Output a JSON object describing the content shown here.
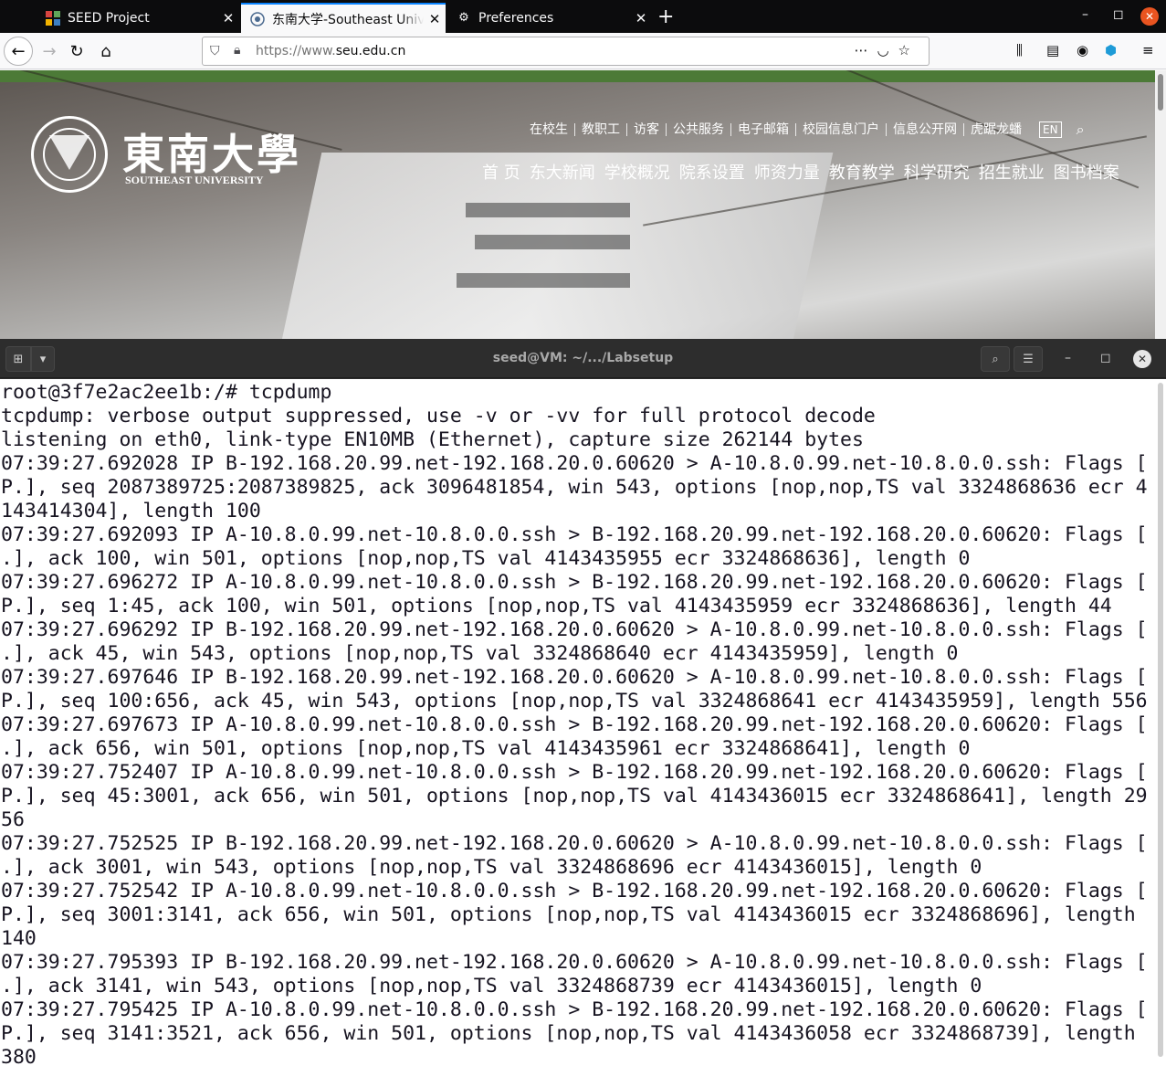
{
  "browser": {
    "tabs": [
      {
        "title": "SEED Project",
        "icon": "seed-grid-icon"
      },
      {
        "title": "东南大学-Southeast University",
        "icon": "seu-seal-icon"
      },
      {
        "title": "Preferences",
        "icon": "gear-icon"
      }
    ],
    "url_prefix": "https://www.",
    "url_domain": "seu.edu.cn",
    "toolbar_icons": [
      "library-icon",
      "reader-view-icon",
      "account-icon",
      "extension-icon",
      "menu-icon"
    ]
  },
  "site": {
    "logo_cn": "東南大學",
    "logo_en": "SOUTHEAST UNIVERSITY",
    "top_nav": [
      "在校生",
      "教职工",
      "访客",
      "公共服务",
      "电子邮箱",
      "校园信息门户",
      "信息公开网",
      "虎踞龙蟠"
    ],
    "lang": "EN",
    "main_nav": [
      "首 页",
      "东大新闻",
      "学校概况",
      "院系设置",
      "师资力量",
      "教育教学",
      "科学研究",
      "招生就业",
      "图书档案"
    ]
  },
  "terminal": {
    "title": "seed@VM: ~/.../Labsetup",
    "lines": [
      "root@3f7e2ac2ee1b:/# tcpdump",
      "tcpdump: verbose output suppressed, use -v or -vv for full protocol decode",
      "listening on eth0, link-type EN10MB (Ethernet), capture size 262144 bytes",
      "07:39:27.692028 IP B-192.168.20.99.net-192.168.20.0.60620 > A-10.8.0.99.net-10.8.0.0.ssh: Flags [",
      "P.], seq 2087389725:2087389825, ack 3096481854, win 543, options [nop,nop,TS val 3324868636 ecr 4",
      "143414304], length 100",
      "07:39:27.692093 IP A-10.8.0.99.net-10.8.0.0.ssh > B-192.168.20.99.net-192.168.20.0.60620: Flags [",
      ".], ack 100, win 501, options [nop,nop,TS val 4143435955 ecr 3324868636], length 0",
      "07:39:27.696272 IP A-10.8.0.99.net-10.8.0.0.ssh > B-192.168.20.99.net-192.168.20.0.60620: Flags [",
      "P.], seq 1:45, ack 100, win 501, options [nop,nop,TS val 4143435959 ecr 3324868636], length 44",
      "07:39:27.696292 IP B-192.168.20.99.net-192.168.20.0.60620 > A-10.8.0.99.net-10.8.0.0.ssh: Flags [",
      ".], ack 45, win 543, options [nop,nop,TS val 3324868640 ecr 4143435959], length 0",
      "07:39:27.697646 IP B-192.168.20.99.net-192.168.20.0.60620 > A-10.8.0.99.net-10.8.0.0.ssh: Flags [",
      "P.], seq 100:656, ack 45, win 543, options [nop,nop,TS val 3324868641 ecr 4143435959], length 556",
      "07:39:27.697673 IP A-10.8.0.99.net-10.8.0.0.ssh > B-192.168.20.99.net-192.168.20.0.60620: Flags [",
      ".], ack 656, win 501, options [nop,nop,TS val 4143435961 ecr 3324868641], length 0",
      "07:39:27.752407 IP A-10.8.0.99.net-10.8.0.0.ssh > B-192.168.20.99.net-192.168.20.0.60620: Flags [",
      "P.], seq 45:3001, ack 656, win 501, options [nop,nop,TS val 4143436015 ecr 3324868641], length 29",
      "56",
      "07:39:27.752525 IP B-192.168.20.99.net-192.168.20.0.60620 > A-10.8.0.99.net-10.8.0.0.ssh: Flags [",
      ".], ack 3001, win 543, options [nop,nop,TS val 3324868696 ecr 4143436015], length 0",
      "07:39:27.752542 IP A-10.8.0.99.net-10.8.0.0.ssh > B-192.168.20.99.net-192.168.20.0.60620: Flags [",
      "P.], seq 3001:3141, ack 656, win 501, options [nop,nop,TS val 4143436015 ecr 3324868696], length",
      "140",
      "07:39:27.795393 IP B-192.168.20.99.net-192.168.20.0.60620 > A-10.8.0.99.net-10.8.0.0.ssh: Flags [",
      ".], ack 3141, win 543, options [nop,nop,TS val 3324868739 ecr 4143436015], length 0",
      "07:39:27.795425 IP A-10.8.0.99.net-10.8.0.0.ssh > B-192.168.20.99.net-192.168.20.0.60620: Flags [",
      "P.], seq 3141:3521, ack 656, win 501, options [nop,nop,TS val 4143436058 ecr 3324868739], length",
      "380"
    ]
  }
}
